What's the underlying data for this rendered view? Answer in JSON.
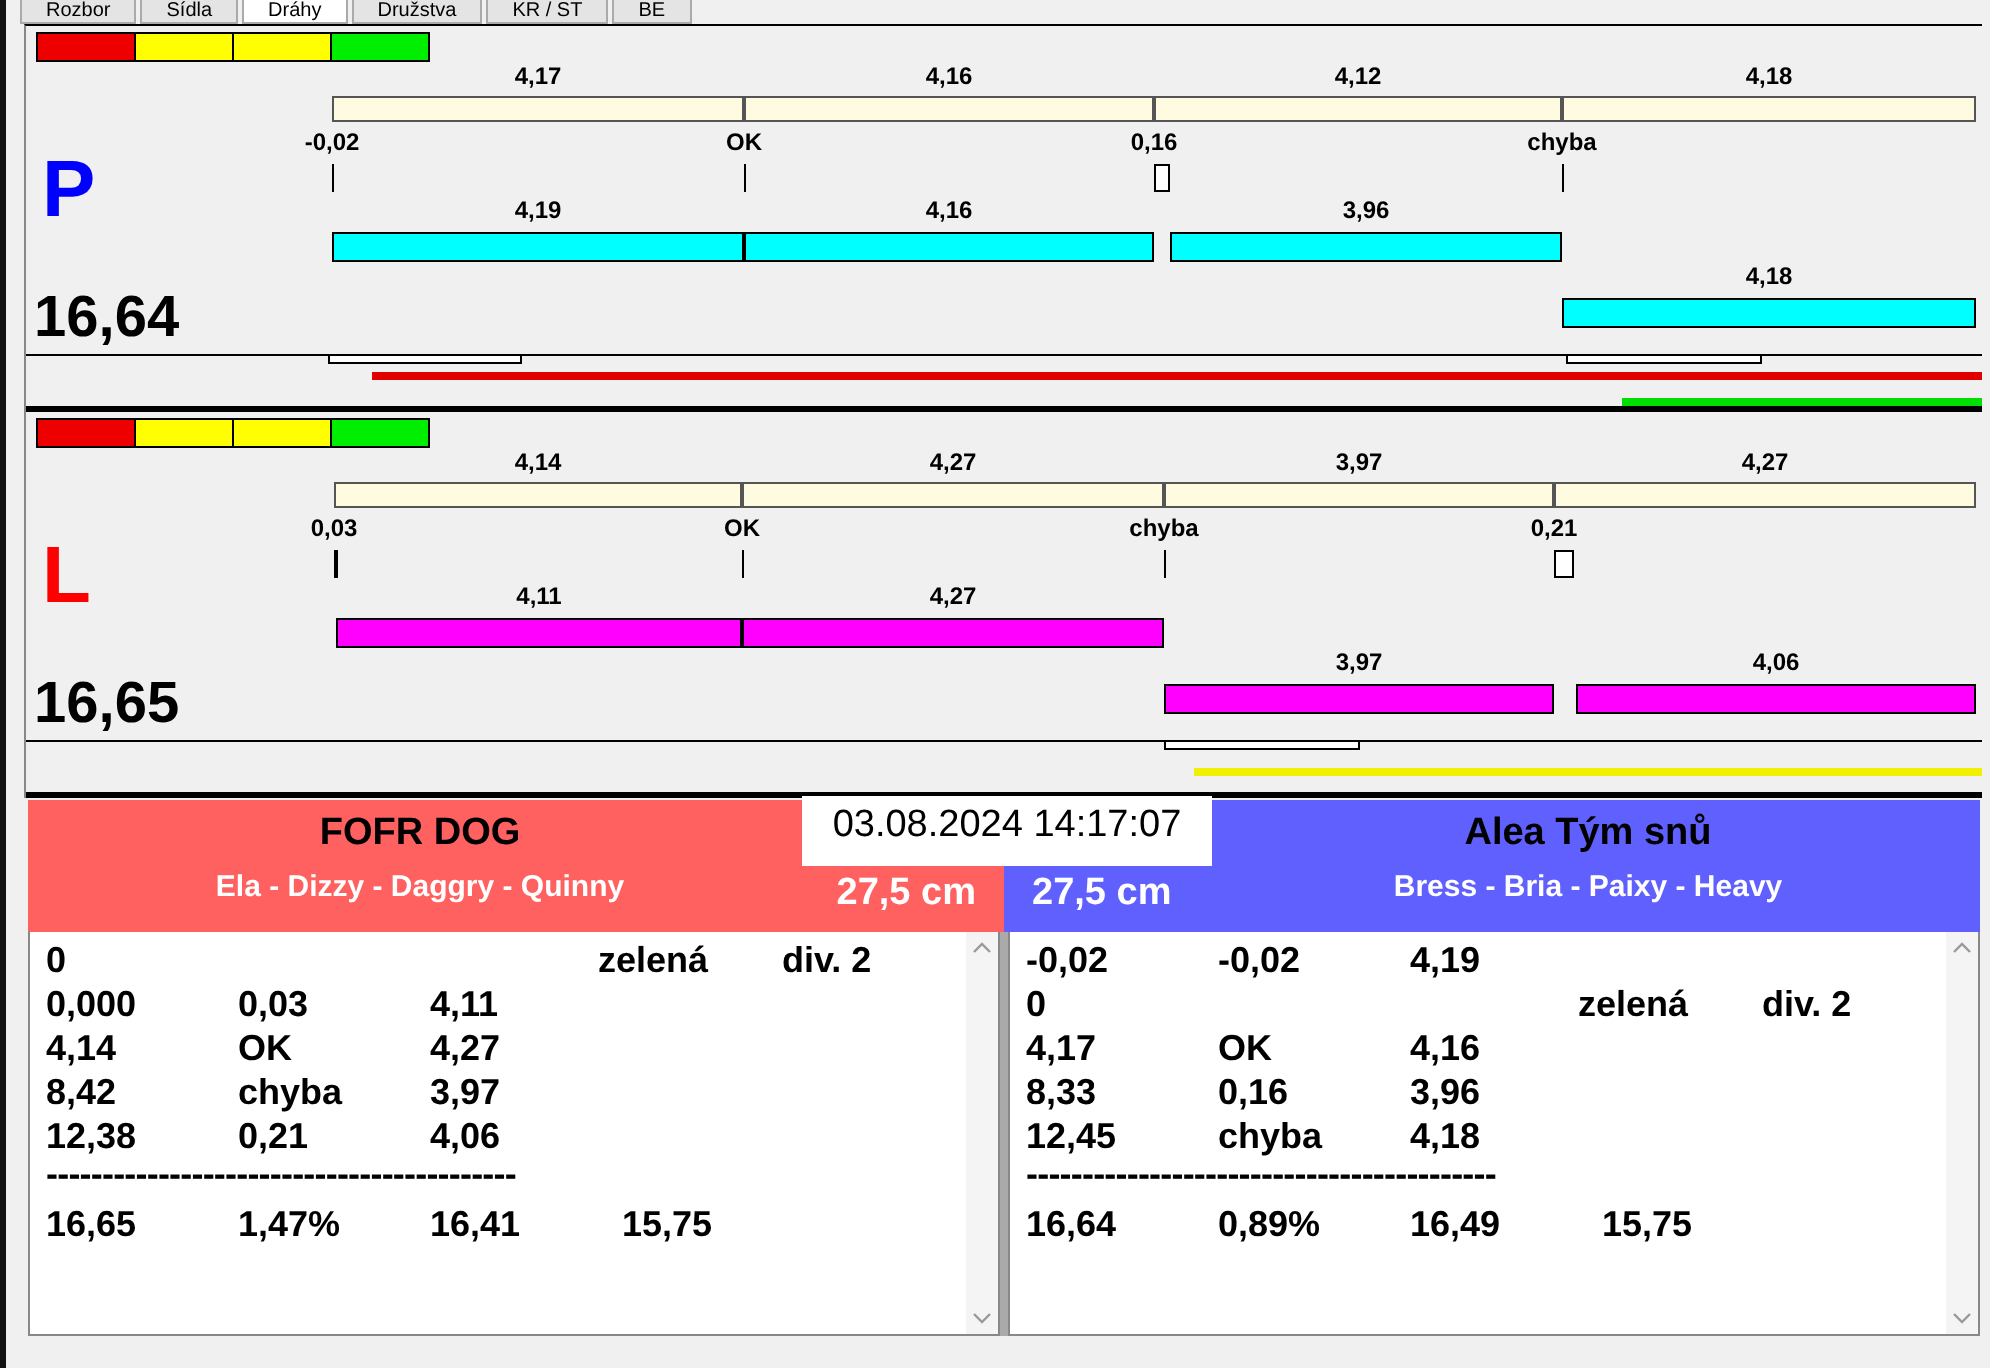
{
  "tabs": [
    {
      "label": "Rozbor",
      "selected": false
    },
    {
      "label": "Sídla",
      "selected": false
    },
    {
      "label": "Dráhy",
      "selected": true
    },
    {
      "label": "Družstva",
      "selected": false
    },
    {
      "label": "KR / ST",
      "selected": false
    },
    {
      "label": "BE",
      "selected": false
    }
  ],
  "lanes": [
    {
      "letter": "P",
      "color": "#0000ff",
      "total": "16,64",
      "segments": [
        "4,17",
        "4,16",
        "4,12",
        "4,18"
      ],
      "marks": [
        "-0,02",
        "OK",
        "0,16",
        "chyba"
      ],
      "rows": [
        {
          "color": "#00ffff",
          "values": [
            "4,19",
            "4,16",
            "3,96"
          ]
        },
        {
          "color": "#00ffff",
          "values": [
            "4,18"
          ]
        }
      ]
    },
    {
      "letter": "L",
      "color": "#ff0000",
      "total": "16,65",
      "segments": [
        "4,14",
        "4,27",
        "3,97",
        "4,27"
      ],
      "marks": [
        "0,03",
        "OK",
        "chyba",
        "0,21"
      ],
      "rows": [
        {
          "color": "#ff00ff",
          "values": [
            "4,11",
            "4,27"
          ]
        },
        {
          "color": "#ff00ff",
          "values": [
            "3,97",
            "4,06"
          ]
        }
      ]
    }
  ],
  "datetime": "03.08.2024 14:17:07",
  "teams": [
    {
      "name": "FOFR DOG",
      "members": "Ela - Dizzy - Daggry - Quinny",
      "distance": "27,5 cm",
      "color": "#ff6060",
      "lines": [
        {
          "kind": "row",
          "cells": [
            "0",
            "",
            "",
            "zelená",
            "div. 2"
          ]
        },
        {
          "kind": "row",
          "cells": [
            "0,000",
            "0,03",
            "4,11"
          ]
        },
        {
          "kind": "row",
          "cells": [
            "4,14",
            "OK",
            "4,27"
          ]
        },
        {
          "kind": "row",
          "cells": [
            "8,42",
            "chyba",
            "3,97"
          ]
        },
        {
          "kind": "row",
          "cells": [
            "12,38",
            "0,21",
            "4,06"
          ]
        },
        {
          "kind": "separator",
          "text": "------------------------------------------"
        },
        {
          "kind": "row",
          "cells": [
            "16,65",
            "1,47%",
            "16,41",
            "15,75"
          ]
        }
      ]
    },
    {
      "name": "Alea Tým snů",
      "members": "Bress - Bria - Paixy - Heavy",
      "distance": "27,5 cm",
      "color": "#6060ff",
      "lines": [
        {
          "kind": "row",
          "cells": [
            "-0,02",
            "-0,02",
            "4,19"
          ]
        },
        {
          "kind": "row",
          "cells": [
            "0",
            "",
            "",
            "zelená",
            "div. 2"
          ]
        },
        {
          "kind": "row",
          "cells": [
            "4,17",
            "OK",
            "4,16"
          ]
        },
        {
          "kind": "row",
          "cells": [
            "8,33",
            "0,16",
            "3,96"
          ]
        },
        {
          "kind": "row",
          "cells": [
            "12,45",
            "chyba",
            "4,18"
          ]
        },
        {
          "kind": "separator",
          "text": "------------------------------------------"
        },
        {
          "kind": "row",
          "cells": [
            "16,64",
            "0,89%",
            "16,49",
            "15,75"
          ]
        }
      ]
    }
  ]
}
